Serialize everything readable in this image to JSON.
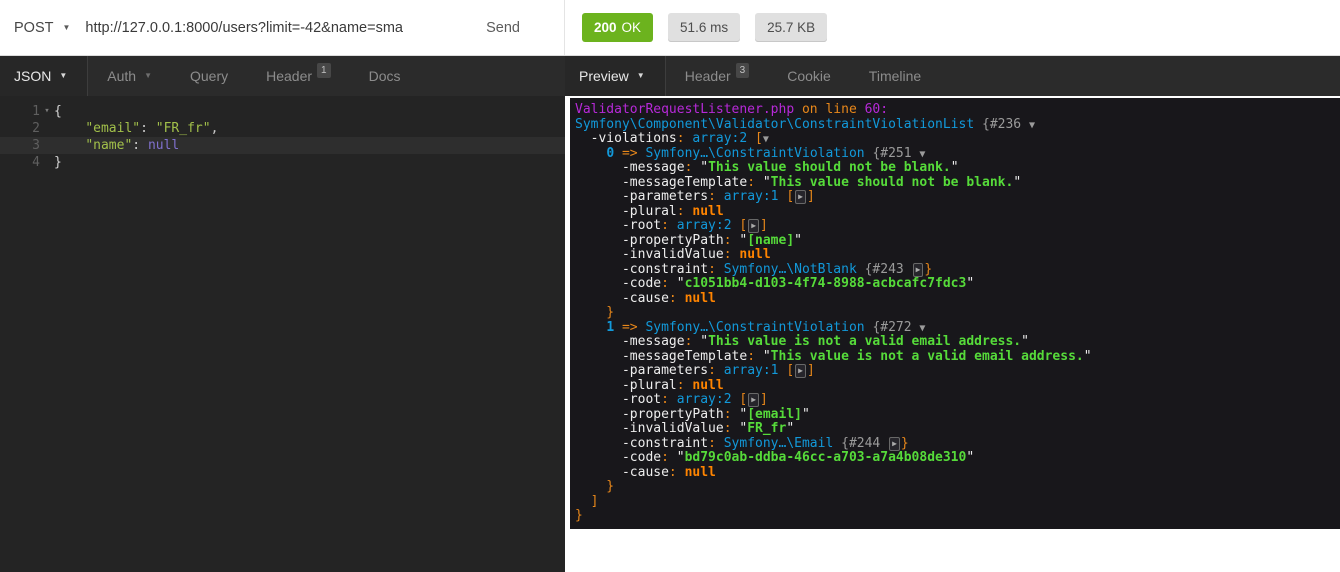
{
  "request_bar": {
    "method": "POST",
    "url": "http://127.0.0.1:8000/users?limit=-42&name=sma",
    "send_label": "Send"
  },
  "response_bar": {
    "status_code": "200",
    "status_text": "OK",
    "time": "51.6 ms",
    "size": "25.7 KB",
    "status_color": "#6cb31e"
  },
  "request_tabs": {
    "body_type": "JSON",
    "auth_label": "Auth",
    "query_label": "Query",
    "header_label": "Header",
    "header_badge": "1",
    "docs_label": "Docs"
  },
  "response_tabs": {
    "view_type": "Preview",
    "header_label": "Header",
    "header_badge": "3",
    "cookie_label": "Cookie",
    "timeline_label": "Timeline"
  },
  "colors": {
    "editor_background": "#242424",
    "tabbar_background": "#2b2b2b",
    "dump_background": "#18171b",
    "dump_class_blue": "#1299da",
    "dump_string_green": "#56db3a",
    "dump_orange": "#e8871a",
    "dump_magenta": "#b729d9"
  },
  "request_body_editor": {
    "language": "JSON",
    "active_line": 3,
    "lines": [
      {
        "num": "1",
        "fold": true,
        "active": false,
        "tokens": [
          {
            "c": "br",
            "t": "{"
          }
        ]
      },
      {
        "num": "2",
        "fold": false,
        "active": false,
        "tokens": [
          {
            "c": "pn",
            "t": "    "
          },
          {
            "c": "key",
            "t": "\"email\""
          },
          {
            "c": "pn",
            "t": ": "
          },
          {
            "c": "str",
            "t": "\"FR_fr\""
          },
          {
            "c": "pn",
            "t": ","
          }
        ]
      },
      {
        "num": "3",
        "fold": false,
        "active": true,
        "tokens": [
          {
            "c": "pn",
            "t": "    "
          },
          {
            "c": "key",
            "t": "\"name\""
          },
          {
            "c": "pn",
            "t": ": "
          },
          {
            "c": "nul",
            "t": "null"
          }
        ]
      },
      {
        "num": "4",
        "fold": false,
        "active": false,
        "tokens": [
          {
            "c": "br",
            "t": "}"
          }
        ]
      }
    ]
  },
  "response_preview": {
    "dump_lines": [
      [
        {
          "c": "meta",
          "t": "ValidatorRequestListener.php"
        },
        {
          "c": "pun",
          "t": " on line "
        },
        {
          "c": "meta",
          "t": "60:"
        }
      ],
      [
        {
          "c": "note",
          "t": "Symfony\\Component\\Validator\\ConstraintViolationList"
        },
        {
          "c": "txt",
          "t": " "
        },
        {
          "c": "ref",
          "t": "{#236"
        },
        {
          "c": "txt",
          "t": " "
        },
        {
          "c": "tog",
          "t": "▼"
        }
      ],
      [
        {
          "c": "txt",
          "t": "  -violations"
        },
        {
          "c": "pun",
          "t": ": "
        },
        {
          "c": "note",
          "t": "array:2"
        },
        {
          "c": "txt",
          "t": " "
        },
        {
          "c": "pun",
          "t": "["
        },
        {
          "c": "tog",
          "t": "▼"
        }
      ],
      [
        {
          "c": "txt",
          "t": "    "
        },
        {
          "c": "idx",
          "t": "0"
        },
        {
          "c": "pun",
          "t": " => "
        },
        {
          "c": "note",
          "t": "Symfony…\\ConstraintViolation"
        },
        {
          "c": "txt",
          "t": " "
        },
        {
          "c": "ref",
          "t": "{#251"
        },
        {
          "c": "txt",
          "t": " "
        },
        {
          "c": "tog",
          "t": "▼"
        }
      ],
      [
        {
          "c": "txt",
          "t": "      -message"
        },
        {
          "c": "pun",
          "t": ": "
        },
        {
          "c": "txt",
          "t": "\""
        },
        {
          "c": "str",
          "t": "This value should not be blank."
        },
        {
          "c": "txt",
          "t": "\""
        }
      ],
      [
        {
          "c": "txt",
          "t": "      -messageTemplate"
        },
        {
          "c": "pun",
          "t": ": "
        },
        {
          "c": "txt",
          "t": "\""
        },
        {
          "c": "str",
          "t": "This value should not be blank."
        },
        {
          "c": "txt",
          "t": "\""
        }
      ],
      [
        {
          "c": "txt",
          "t": "      -parameters"
        },
        {
          "c": "pun",
          "t": ": "
        },
        {
          "c": "note",
          "t": "array:1"
        },
        {
          "c": "txt",
          "t": " "
        },
        {
          "c": "pun",
          "t": "["
        },
        {
          "c": "togc",
          "t": "▶"
        },
        {
          "c": "pun",
          "t": "]"
        }
      ],
      [
        {
          "c": "txt",
          "t": "      -plural"
        },
        {
          "c": "pun",
          "t": ": "
        },
        {
          "c": "nul",
          "t": "null"
        }
      ],
      [
        {
          "c": "txt",
          "t": "      -root"
        },
        {
          "c": "pun",
          "t": ": "
        },
        {
          "c": "note",
          "t": "array:2"
        },
        {
          "c": "txt",
          "t": " "
        },
        {
          "c": "pun",
          "t": "["
        },
        {
          "c": "togc",
          "t": "▶"
        },
        {
          "c": "pun",
          "t": "]"
        }
      ],
      [
        {
          "c": "txt",
          "t": "      -propertyPath"
        },
        {
          "c": "pun",
          "t": ": "
        },
        {
          "c": "txt",
          "t": "\""
        },
        {
          "c": "str",
          "t": "[name]"
        },
        {
          "c": "txt",
          "t": "\""
        }
      ],
      [
        {
          "c": "txt",
          "t": "      -invalidValue"
        },
        {
          "c": "pun",
          "t": ": "
        },
        {
          "c": "nul",
          "t": "null"
        }
      ],
      [
        {
          "c": "txt",
          "t": "      -constraint"
        },
        {
          "c": "pun",
          "t": ": "
        },
        {
          "c": "note",
          "t": "Symfony…\\NotBlank"
        },
        {
          "c": "txt",
          "t": " "
        },
        {
          "c": "ref",
          "t": "{#243"
        },
        {
          "c": "txt",
          "t": " "
        },
        {
          "c": "togc",
          "t": "▶"
        },
        {
          "c": "pun",
          "t": "}"
        }
      ],
      [
        {
          "c": "txt",
          "t": "      -code"
        },
        {
          "c": "pun",
          "t": ": "
        },
        {
          "c": "txt",
          "t": "\""
        },
        {
          "c": "str",
          "t": "c1051bb4-d103-4f74-8988-acbcafc7fdc3"
        },
        {
          "c": "txt",
          "t": "\""
        }
      ],
      [
        {
          "c": "txt",
          "t": "      -cause"
        },
        {
          "c": "pun",
          "t": ": "
        },
        {
          "c": "nul",
          "t": "null"
        }
      ],
      [
        {
          "c": "pun",
          "t": "    }"
        }
      ],
      [
        {
          "c": "txt",
          "t": "    "
        },
        {
          "c": "idx",
          "t": "1"
        },
        {
          "c": "pun",
          "t": " => "
        },
        {
          "c": "note",
          "t": "Symfony…\\ConstraintViolation"
        },
        {
          "c": "txt",
          "t": " "
        },
        {
          "c": "ref",
          "t": "{#272"
        },
        {
          "c": "txt",
          "t": " "
        },
        {
          "c": "tog",
          "t": "▼"
        }
      ],
      [
        {
          "c": "txt",
          "t": "      -message"
        },
        {
          "c": "pun",
          "t": ": "
        },
        {
          "c": "txt",
          "t": "\""
        },
        {
          "c": "str",
          "t": "This value is not a valid email address."
        },
        {
          "c": "txt",
          "t": "\""
        }
      ],
      [
        {
          "c": "txt",
          "t": "      -messageTemplate"
        },
        {
          "c": "pun",
          "t": ": "
        },
        {
          "c": "txt",
          "t": "\""
        },
        {
          "c": "str",
          "t": "This value is not a valid email address."
        },
        {
          "c": "txt",
          "t": "\""
        }
      ],
      [
        {
          "c": "txt",
          "t": "      -parameters"
        },
        {
          "c": "pun",
          "t": ": "
        },
        {
          "c": "note",
          "t": "array:1"
        },
        {
          "c": "txt",
          "t": " "
        },
        {
          "c": "pun",
          "t": "["
        },
        {
          "c": "togc",
          "t": "▶"
        },
        {
          "c": "pun",
          "t": "]"
        }
      ],
      [
        {
          "c": "txt",
          "t": "      -plural"
        },
        {
          "c": "pun",
          "t": ": "
        },
        {
          "c": "nul",
          "t": "null"
        }
      ],
      [
        {
          "c": "txt",
          "t": "      -root"
        },
        {
          "c": "pun",
          "t": ": "
        },
        {
          "c": "note",
          "t": "array:2"
        },
        {
          "c": "txt",
          "t": " "
        },
        {
          "c": "pun",
          "t": "["
        },
        {
          "c": "togc",
          "t": "▶"
        },
        {
          "c": "pun",
          "t": "]"
        }
      ],
      [
        {
          "c": "txt",
          "t": "      -propertyPath"
        },
        {
          "c": "pun",
          "t": ": "
        },
        {
          "c": "txt",
          "t": "\""
        },
        {
          "c": "str",
          "t": "[email]"
        },
        {
          "c": "txt",
          "t": "\""
        }
      ],
      [
        {
          "c": "txt",
          "t": "      -invalidValue"
        },
        {
          "c": "pun",
          "t": ": "
        },
        {
          "c": "txt",
          "t": "\""
        },
        {
          "c": "str",
          "t": "FR_fr"
        },
        {
          "c": "txt",
          "t": "\""
        }
      ],
      [
        {
          "c": "txt",
          "t": "      -constraint"
        },
        {
          "c": "pun",
          "t": ": "
        },
        {
          "c": "note",
          "t": "Symfony…\\Email"
        },
        {
          "c": "txt",
          "t": " "
        },
        {
          "c": "ref",
          "t": "{#244"
        },
        {
          "c": "txt",
          "t": " "
        },
        {
          "c": "togc",
          "t": "▶"
        },
        {
          "c": "pun",
          "t": "}"
        }
      ],
      [
        {
          "c": "txt",
          "t": "      -code"
        },
        {
          "c": "pun",
          "t": ": "
        },
        {
          "c": "txt",
          "t": "\""
        },
        {
          "c": "str",
          "t": "bd79c0ab-ddba-46cc-a703-a7a4b08de310"
        },
        {
          "c": "txt",
          "t": "\""
        }
      ],
      [
        {
          "c": "txt",
          "t": "      -cause"
        },
        {
          "c": "pun",
          "t": ": "
        },
        {
          "c": "nul",
          "t": "null"
        }
      ],
      [
        {
          "c": "pun",
          "t": "    }"
        }
      ],
      [
        {
          "c": "pun",
          "t": "  ]"
        }
      ],
      [
        {
          "c": "pun",
          "t": "}"
        }
      ]
    ]
  }
}
